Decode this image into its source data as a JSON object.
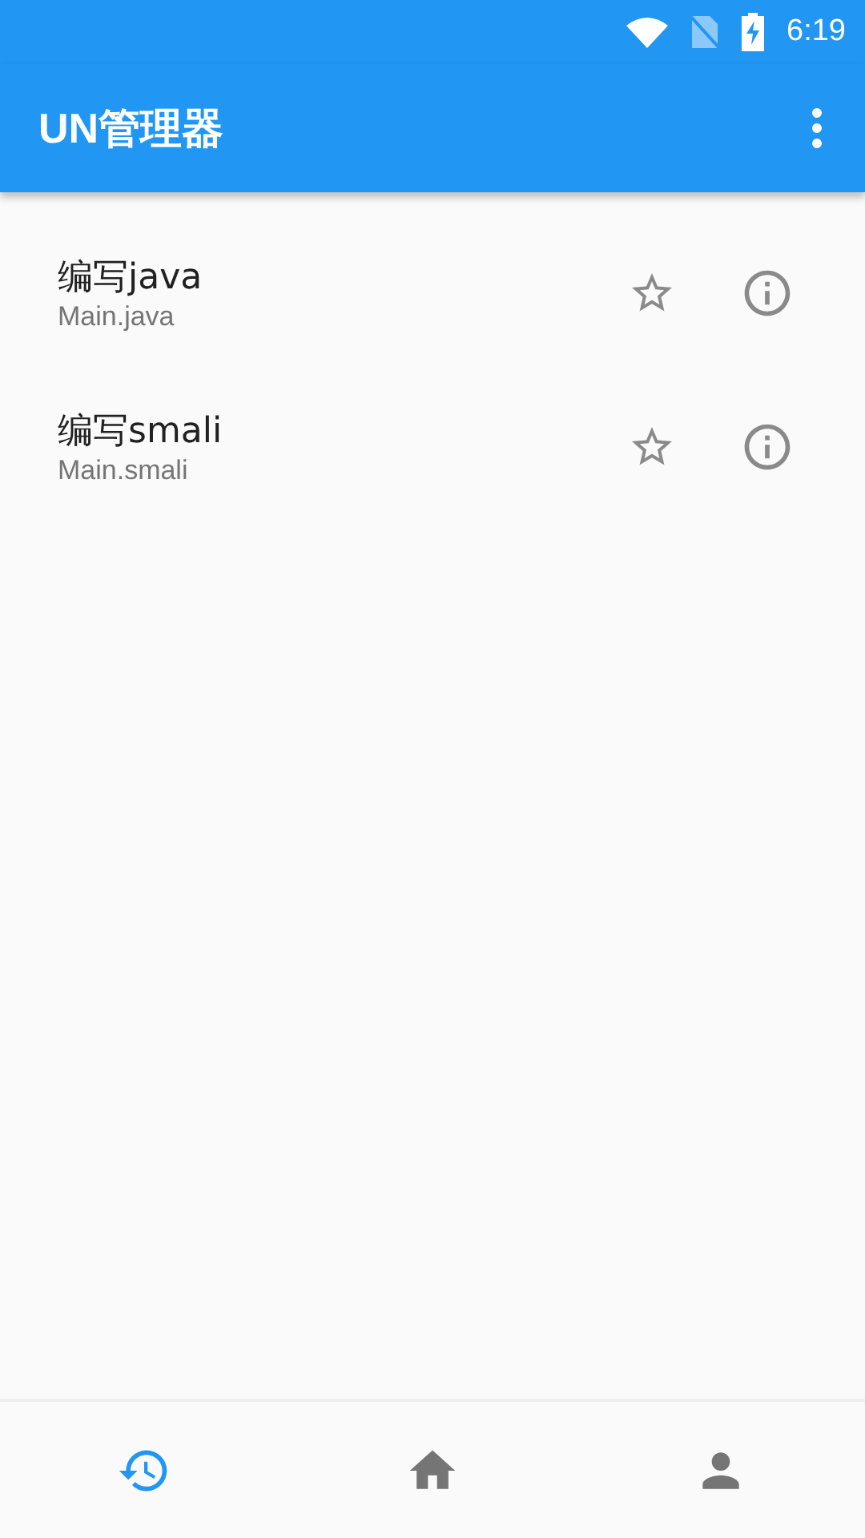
{
  "status_bar": {
    "time": "6:19"
  },
  "app_bar": {
    "title": "UN管理器"
  },
  "items": [
    {
      "title": "编写java",
      "subtitle": "Main.java"
    },
    {
      "title": "编写smali",
      "subtitle": "Main.smali"
    }
  ],
  "bottom_nav": [
    {
      "kind": "history",
      "selected": true
    },
    {
      "kind": "home",
      "selected": false
    },
    {
      "kind": "person",
      "selected": false
    }
  ]
}
